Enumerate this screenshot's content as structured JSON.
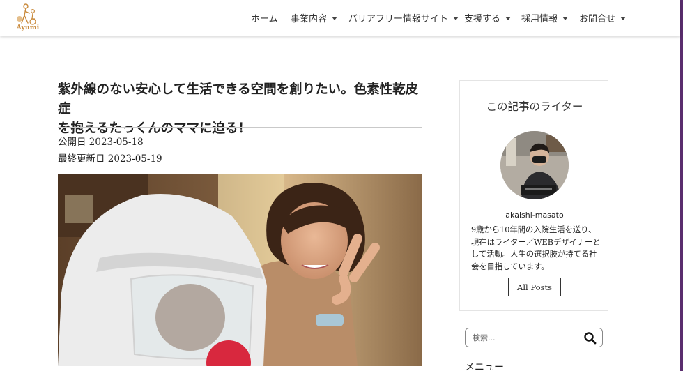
{
  "header": {
    "logo_text": "Ayumi",
    "nav": [
      {
        "label": "ホーム",
        "has_caret": false
      },
      {
        "label": "事業内容",
        "has_caret": true
      },
      {
        "label": "バリアフリー情報サイト",
        "has_caret": true
      },
      {
        "label": "支援する",
        "has_caret": true
      },
      {
        "label": "採用情報",
        "has_caret": true
      },
      {
        "label": "お問合せ",
        "has_caret": true
      }
    ]
  },
  "article": {
    "title_line1": "紫外線のない安心して生活できる空間を創りたい。色素性乾皮症",
    "title_line2": "を抱えるたっくんのママに迫る！",
    "published": "公開日 2023-05-18",
    "updated": "最終更新日 2023-05-19"
  },
  "writer": {
    "heading": "この記事のライター",
    "name": "akaishi-masato",
    "bio": "9歳から10年間の入院生活を送り、現在はライター／WEBデザイナーとして活動。人生の選択肢が持てる社会を目指しています。",
    "all_posts": "All Posts"
  },
  "search": {
    "placeholder": "検索..."
  },
  "sidebar": {
    "menu_heading": "メニュー"
  },
  "colors": {
    "accent": "#c98a3c",
    "edge": "#7b1e6a"
  }
}
